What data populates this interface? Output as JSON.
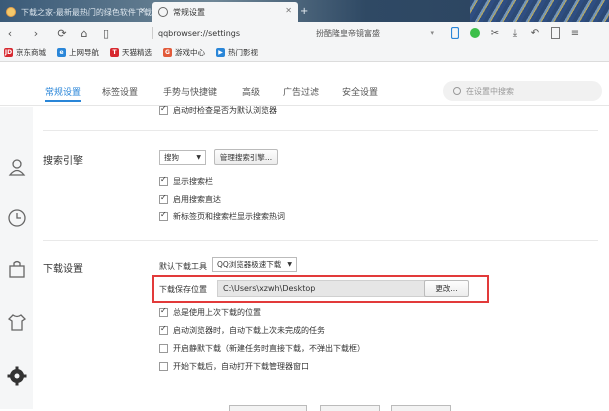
{
  "tabs": [
    {
      "title": "下载之家-最新最热门的绿色软件下载",
      "active": false
    },
    {
      "title": "常规设置",
      "active": true
    }
  ],
  "address": {
    "url": "qqbrowser://settings"
  },
  "omnibox": {
    "text": "扮酷隆皇帝镜富盛"
  },
  "toolbar_icons": [
    "phone-icon",
    "chat-icon",
    "scissors-icon",
    "download-icon",
    "undo-icon",
    "document-icon",
    "menu-icon"
  ],
  "bookmarks": [
    {
      "label": "京东商城",
      "icon": "jd-icon",
      "color": "#d7282f",
      "glyph": "JD"
    },
    {
      "label": "上网导航",
      "icon": "globe-icon",
      "color": "#2a86d8",
      "glyph": "e"
    },
    {
      "label": "天猫精选",
      "icon": "tmall-icon",
      "color": "#d7282f",
      "glyph": "T"
    },
    {
      "label": "游戏中心",
      "icon": "game-icon",
      "color": "#e25a3a",
      "glyph": "G"
    },
    {
      "label": "热门影视",
      "icon": "play-icon",
      "color": "#2a86d8",
      "glyph": "▶"
    }
  ],
  "settings_tabs": [
    "常规设置",
    "标签设置",
    "手势与快捷键",
    "高级",
    "广告过滤",
    "安全设置"
  ],
  "active_settings_tab": "常规设置",
  "search": {
    "placeholder": "在设置中搜索"
  },
  "partial_top_row": {
    "label": "启动时检查是否为默认浏览器",
    "checked": true
  },
  "search_engine": {
    "title": "搜索引擎",
    "engine_value": "搜狗",
    "manage_button": "管理搜索引擎...",
    "options": [
      {
        "label": "显示搜索栏",
        "checked": true
      },
      {
        "label": "启用搜索直达",
        "checked": true
      },
      {
        "label": "新标签页和搜索栏显示搜索热词",
        "checked": true
      }
    ]
  },
  "download": {
    "title": "下载设置",
    "tool_label": "默认下载工具",
    "tool_value": "QQ浏览器极速下载",
    "path_label": "下载保存位置",
    "path_value": "C:\\Users\\xzwh\\Desktop",
    "change_button": "更改...",
    "options": [
      {
        "label": "总是使用上次下载的位置",
        "checked": true
      },
      {
        "label": "启动浏览器时，自动下载上次未完成的任务",
        "checked": true
      },
      {
        "label": "开启静默下载（新建任务时直接下载，不弹出下载框）",
        "checked": false
      },
      {
        "label": "开始下载后，自动打开下载管理器窗口",
        "checked": false
      }
    ]
  },
  "accent_color": "#2a86d8",
  "highlight_color": "#e23a3a"
}
